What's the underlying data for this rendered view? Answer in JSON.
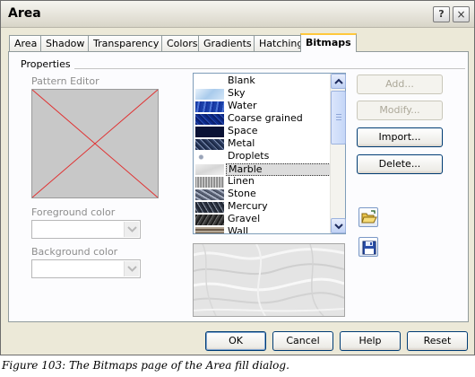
{
  "dialog": {
    "title": "Area",
    "help_icon": "?",
    "close_icon": "×"
  },
  "tabs": [
    "Area",
    "Shadow",
    "Transparency",
    "Colors",
    "Gradients",
    "Hatching",
    "Bitmaps"
  ],
  "active_tab": "Bitmaps",
  "properties": {
    "group_label": "Properties",
    "pattern_editor_label": "Pattern Editor",
    "foreground_color_label": "Foreground color",
    "foreground_color_value": "",
    "background_color_label": "Background color",
    "background_color_value": ""
  },
  "bitmap_list": {
    "items": [
      "Blank",
      "Sky",
      "Water",
      "Coarse grained",
      "Space",
      "Metal",
      "Droplets",
      "Marble",
      "Linen",
      "Stone",
      "Mercury",
      "Gravel",
      "Wall"
    ],
    "selected": "Marble"
  },
  "side_buttons": {
    "add": "Add...",
    "modify": "Modify...",
    "import": "Import...",
    "delete": "Delete..."
  },
  "icons": {
    "load": "open-folder-icon",
    "save": "floppy-disk-icon"
  },
  "footer": {
    "ok": "OK",
    "cancel": "Cancel",
    "help": "Help",
    "reset": "Reset"
  },
  "caption": "Figure 103: The Bitmaps page of the Area fill dialog.",
  "colors": {
    "tab_highlight": "#ffc83c",
    "button_border": "#003c74",
    "disabled_text": "#aca899"
  }
}
